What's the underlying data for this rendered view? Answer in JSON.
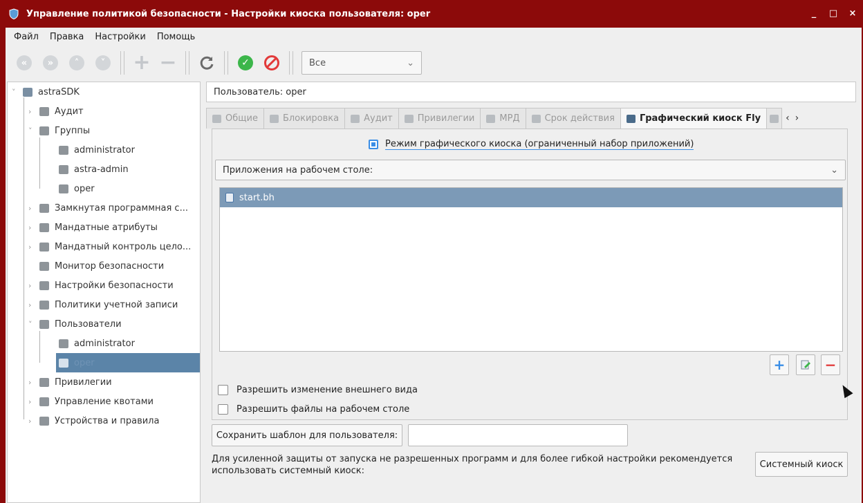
{
  "window": {
    "title": "Управление политикой безопасности - Настройки киоска пользователя: oper",
    "controls": [
      "_",
      "□",
      "×"
    ]
  },
  "menubar": [
    "Файл",
    "Правка",
    "Настройки",
    "Помощь"
  ],
  "toolbar": {
    "filter_value": "Все"
  },
  "tree": {
    "root": "astraSDK",
    "items": [
      {
        "label": "Аудит"
      },
      {
        "label": "Группы"
      },
      {
        "label": "administrator"
      },
      {
        "label": "astra-admin"
      },
      {
        "label": "oper"
      },
      {
        "label": "Замкнутая программная с..."
      },
      {
        "label": "Мандатные атрибуты"
      },
      {
        "label": "Мандатный контроль цело..."
      },
      {
        "label": "Монитор безопасности"
      },
      {
        "label": "Настройки безопасности"
      },
      {
        "label": "Политики учетной записи"
      },
      {
        "label": "Пользователи"
      },
      {
        "label": "administrator"
      },
      {
        "label": "oper"
      },
      {
        "label": "Привилегии"
      },
      {
        "label": "Управление квотами"
      },
      {
        "label": "Устройства и правила"
      }
    ]
  },
  "user_label": "Пользователь: oper",
  "tabs": [
    {
      "label": "Общие"
    },
    {
      "label": "Блокировка"
    },
    {
      "label": "Аудит"
    },
    {
      "label": "Привилегии"
    },
    {
      "label": "МРД"
    },
    {
      "label": "Срок действия"
    },
    {
      "label": "Графический киоск Fly"
    }
  ],
  "kiosk": {
    "mode_label": "Режим графического киоска (ограниченный набор приложений)",
    "apps_select": "Приложения на рабочем столе:",
    "apps": [
      "start.bh"
    ],
    "allow_appearance": "Разрешить изменение внешнего вида",
    "allow_files": "Разрешить файлы на рабочем столе",
    "save_template": "Сохранить шаблон для пользователя:",
    "note": "Для усиленной защиты от запуска не разрешенных программ и для более гибкой настройки рекомендуется использовать системный киоск:",
    "system_kiosk": "Системный киоск"
  },
  "colors": {
    "titlebar": "#8c0a0a",
    "selection": "#5b84a8",
    "list_selection": "#7c9ab7",
    "accent": "#3a8ee6"
  }
}
